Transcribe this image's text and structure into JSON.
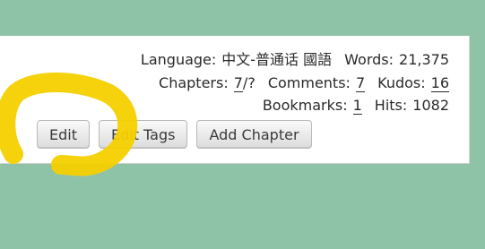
{
  "stats": {
    "language_label": "Language:",
    "language_value": "中文-普通话 國語",
    "words_label": "Words:",
    "words_value": "21,375",
    "chapters_label": "Chapters:",
    "chapters_current": "7",
    "chapters_total": "/?",
    "comments_label": "Comments:",
    "comments_value": "7",
    "kudos_label": "Kudos:",
    "kudos_value": "16",
    "bookmarks_label": "Bookmarks:",
    "bookmarks_value": "1",
    "hits_label": "Hits:",
    "hits_value": "1082"
  },
  "actions": {
    "edit_label": "Edit",
    "edit_tags_label": "Edit Tags",
    "add_chapter_label": "Add Chapter"
  },
  "colors": {
    "background": "#8fc3a7",
    "highlight_marker": "#f5d000"
  }
}
